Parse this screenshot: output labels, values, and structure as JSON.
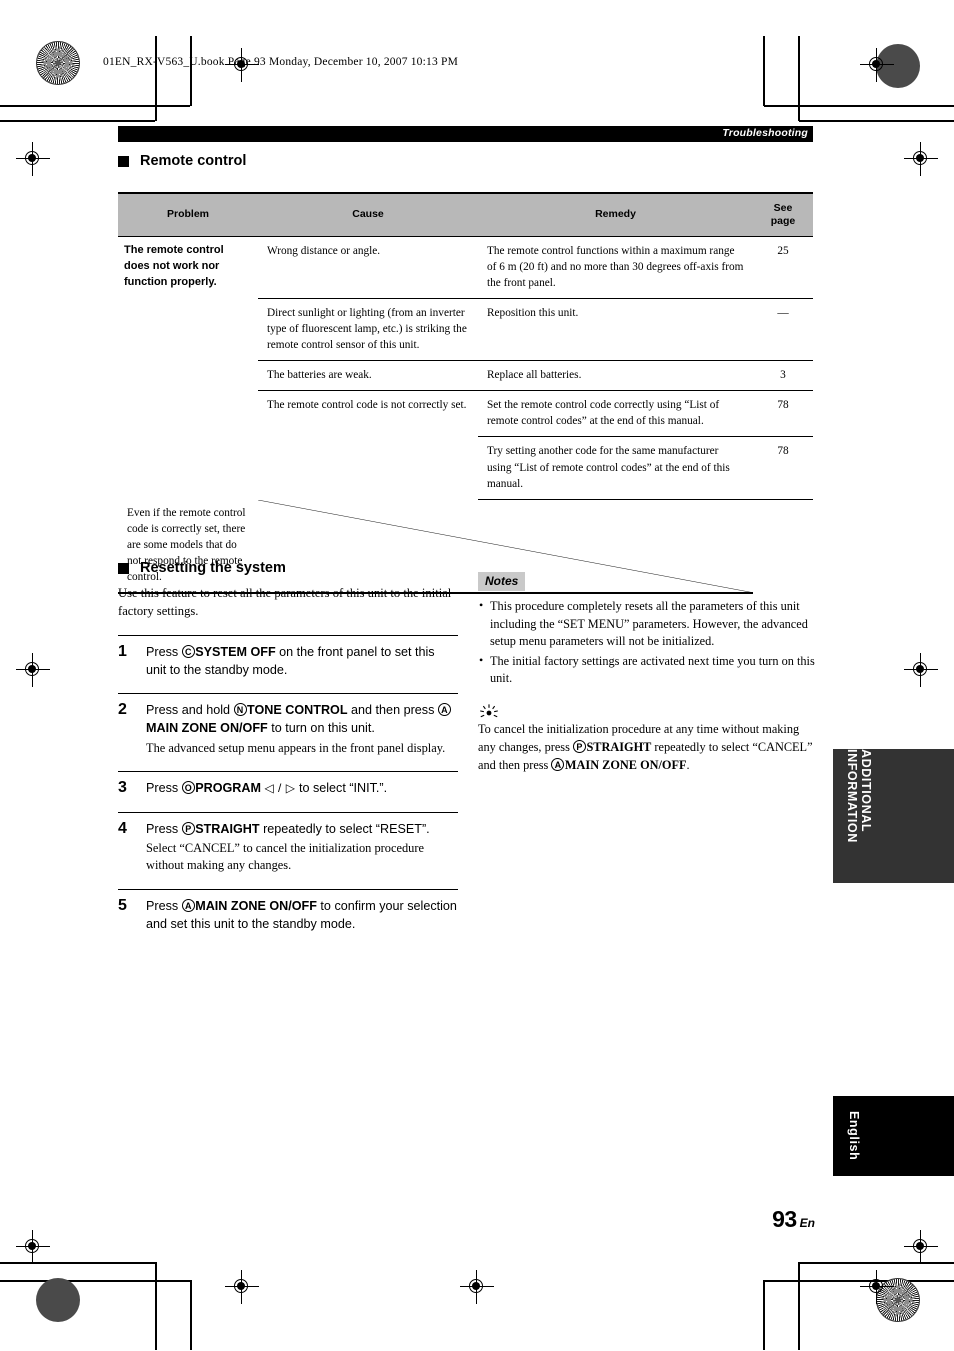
{
  "file_header": "01EN_RX-V563_U.book  Page 93  Monday, December 10, 2007  10:13 PM",
  "chapter_bar": {
    "label": "Troubleshooting"
  },
  "section_remote": {
    "heading": "Remote control"
  },
  "table": {
    "headers": [
      "Problem",
      "Cause",
      "Remedy",
      "See\npage"
    ],
    "header_see_page_line1": "See",
    "header_see_page_line2": "page",
    "rows": [
      {
        "problem": "The remote control does not work nor function properly.",
        "cause": "Wrong distance or angle.",
        "remedy": "The remote control functions within a maximum range of 6 m (20 ft) and no more than 30 degrees off-axis from the front panel.",
        "page": "25"
      },
      {
        "problem": "",
        "cause": "Direct sunlight or lighting (from an inverter type of fluorescent lamp, etc.) is striking the remote control sensor of this unit.",
        "remedy": "Reposition this unit.",
        "page": "—"
      },
      {
        "problem": "",
        "cause": "The batteries are weak.",
        "remedy": "Replace all batteries.",
        "page": "3"
      },
      {
        "problem": "",
        "cause": "The remote control code is not correctly set.",
        "remedy": "Set the remote control code correctly using “List of remote control codes” at the end of this manual.",
        "page": "78"
      },
      {
        "problem": "",
        "cause": "",
        "remedy": "Try setting another code for the same manufacturer using “List of remote control codes” at the end of this manual.",
        "page": "78"
      },
      {
        "problem": "",
        "cause": "Even if the remote control code is correctly set, there are some models that do not respond to the remote control.",
        "remedy": "",
        "page": ""
      }
    ]
  },
  "section_reset": {
    "heading": "Resetting the system",
    "intro": "Use this feature to reset all the parameters of this unit to the initial factory settings.",
    "steps": [
      {
        "num": "1",
        "circle": "C",
        "title_bold": "SYSTEM OFF",
        "title_rest": " on the front panel to set this unit to the standby mode.",
        "title_prefix": "Press ",
        "desc": ""
      },
      {
        "num": "2",
        "circle": "N",
        "title_prefix": "Press and hold ",
        "title_bold": "TONE CONTROL",
        "title_mid": " and then press ",
        "circle2": "A",
        "title_bold2": "MAIN ZONE ON/OFF",
        "title_rest": " to turn on this unit.",
        "desc": "The advanced setup menu appears in the front panel display."
      },
      {
        "num": "3",
        "circle": "O",
        "title_prefix": "Press ",
        "title_bold": "PROGRAM",
        "arrows": "◁ / ▷",
        "title_rest": " to select “INIT.”.",
        "desc": ""
      },
      {
        "num": "4",
        "circle": "P",
        "title_prefix": "Press ",
        "title_bold": "STRAIGHT",
        "title_rest": " repeatedly to select “RESET”.",
        "desc": "Select “CANCEL” to cancel the initialization procedure without making any changes."
      },
      {
        "num": "5",
        "circle": "A",
        "title_prefix": "Press ",
        "title_bold": "MAIN ZONE ON/OFF",
        "title_rest": " to confirm your selection and set this unit to the standby mode.",
        "desc": ""
      }
    ]
  },
  "notes": {
    "label": "Notes",
    "items": [
      "This procedure completely resets all the parameters of this unit including the “SET MENU” parameters. However, the advanced setup menu parameters will not be initialized.",
      "The initial factory settings are activated next time you turn on this unit."
    ]
  },
  "tip": {
    "icon": "tip-sun-icon",
    "text_part1": "To cancel the initialization procedure at any time without making any changes, press ",
    "circle1": "P",
    "bold1": "STRAIGHT",
    "text_part2": " repeatedly to select “CANCEL” and then press ",
    "circle2": "A",
    "bold2": "MAIN ZONE ON/OFF",
    "text_part3": "."
  },
  "side_tabs": {
    "additional": "ADDITIONAL INFORMATION",
    "english": "English"
  },
  "page_number": {
    "number": "93",
    "suffix": "En"
  },
  "colors": {
    "table_header_bg": "#b8b8b8",
    "notes_label_bg": "#c9c9c9",
    "tab_additional_bg": "#333333",
    "tab_english_bg": "#000000",
    "chapter_bar_bg": "#000000"
  }
}
